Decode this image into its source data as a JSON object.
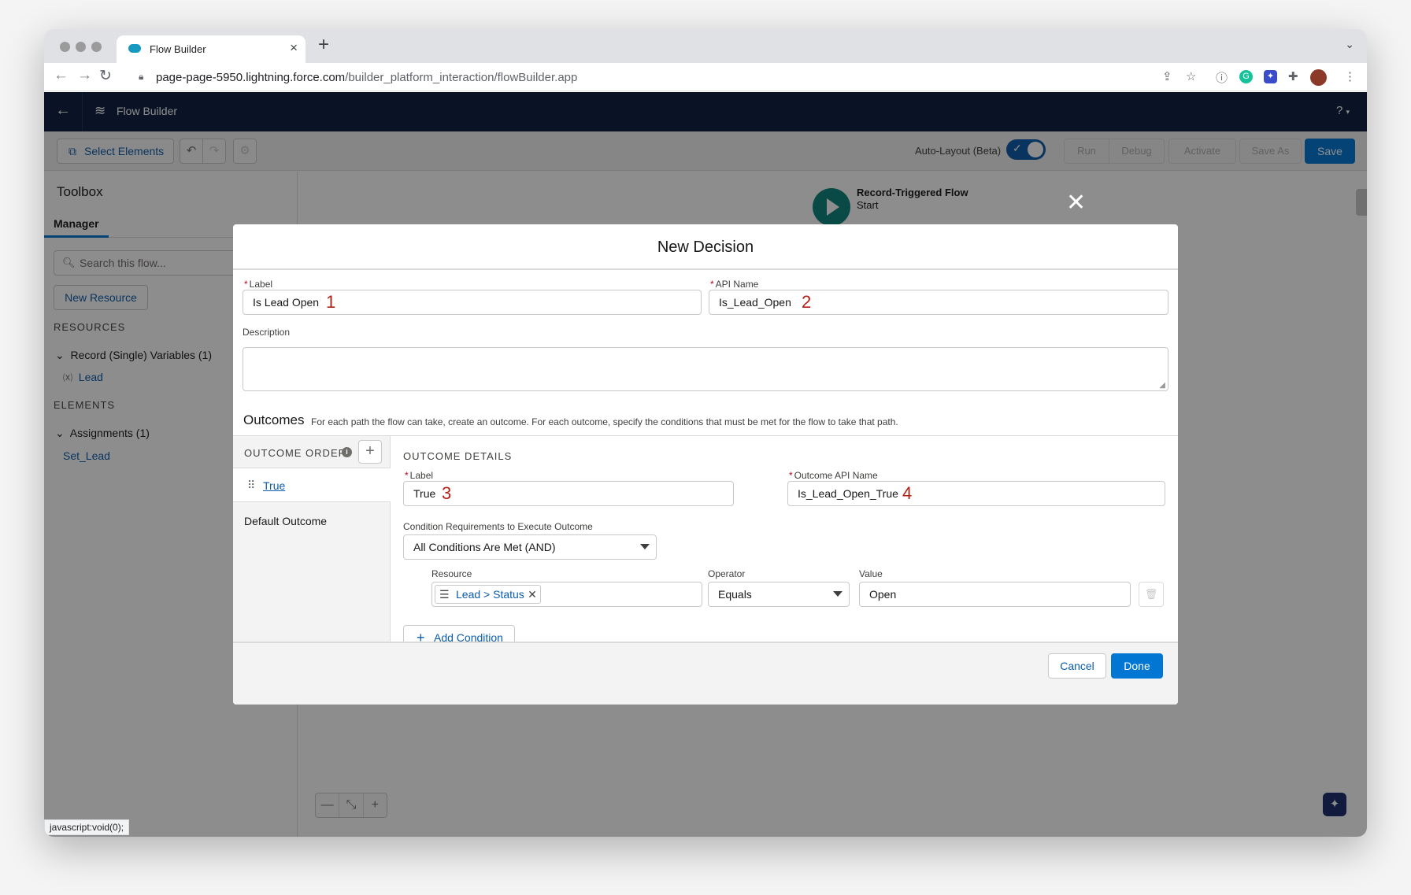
{
  "browser": {
    "tab_title": "Flow Builder",
    "url_host": "page-page-5950.lightning.force.com",
    "url_path": "/builder_platform_interaction/flowBuilder.app"
  },
  "app": {
    "title": "Flow Builder",
    "help": "?"
  },
  "toolbar": {
    "select_elements": "Select Elements",
    "auto_layout_label": "Auto-Layout (Beta)",
    "auto_layout_on": true,
    "run": "Run",
    "debug": "Debug",
    "activate": "Activate",
    "save_as": "Save As",
    "save": "Save"
  },
  "sidebar": {
    "title": "Toolbox",
    "tab": "Manager",
    "search_placeholder": "Search this flow...",
    "new_resource": "New Resource",
    "resources_heading": "RESOURCES",
    "record_variables_group": "Record (Single) Variables (1)",
    "record_variable_item": "Lead",
    "elements_heading": "ELEMENTS",
    "assignments_group": "Assignments (1)",
    "assignment_item": "Set_Lead"
  },
  "canvas": {
    "start_title": "Record-Triggered Flow",
    "start_subtitle": "Start"
  },
  "status_bar": "javascript:void(0);",
  "modal": {
    "title": "New Decision",
    "label_label": "Label",
    "label_value": "Is Lead Open",
    "api_name_label": "API Name",
    "api_name_value": "Is_Lead_Open",
    "description_label": "Description",
    "outcomes_title": "Outcomes",
    "outcomes_desc": "For each path the flow can take, create an outcome. For each outcome, specify the conditions that must be met for the flow to take that path.",
    "outcome_order": "OUTCOME ORDER",
    "outcome_true": "True",
    "outcome_default": "Default Outcome",
    "outcome_details": "OUTCOME DETAILS",
    "outcome_label_label": "Label",
    "outcome_label_value": "True",
    "outcome_api_label": "Outcome API Name",
    "outcome_api_value": "Is_Lead_Open_True",
    "condition_req_label": "Condition Requirements to Execute Outcome",
    "condition_req_value": "All Conditions Are Met (AND)",
    "resource_label": "Resource",
    "resource_value": "Lead > Status",
    "operator_label": "Operator",
    "operator_value": "Equals",
    "value_label": "Value",
    "value_value": "Open",
    "add_condition": "Add Condition",
    "cancel": "Cancel",
    "done": "Done"
  },
  "annotations": [
    "1",
    "2",
    "3",
    "4"
  ]
}
